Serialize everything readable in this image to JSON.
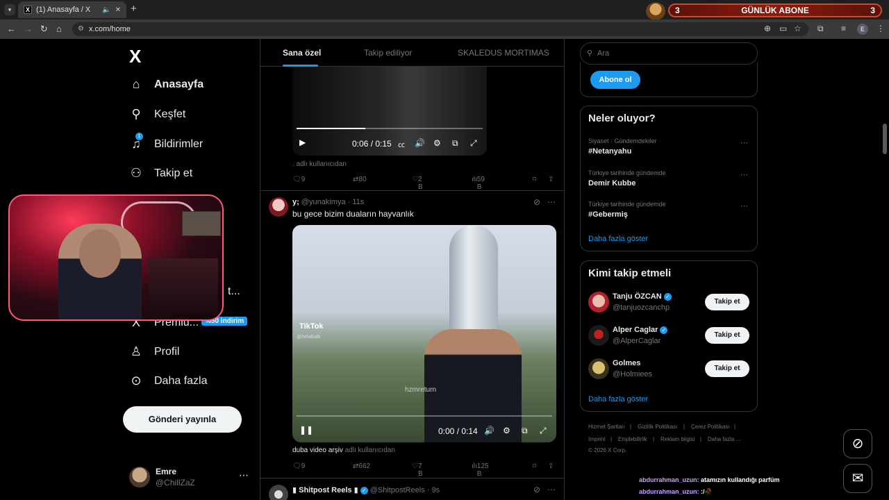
{
  "browser": {
    "tab_title": "(1) Anasayfa / X",
    "tab_favicon": "X",
    "url": "x.com/home",
    "profile_initial": "E",
    "subs_widget": {
      "left_count": "3",
      "label": "GÜNLÜK ABONE",
      "right_count": "3"
    }
  },
  "sidebar": {
    "logo": "X",
    "items": [
      {
        "label": "Anasayfa",
        "icon": "home-icon",
        "glyph": "⌂"
      },
      {
        "label": "Keşfet",
        "icon": "search-icon",
        "glyph": "⚲"
      },
      {
        "label": "Bildirimler",
        "icon": "bell-icon",
        "glyph": "🔔",
        "badge": "1"
      },
      {
        "label": "Takip et",
        "icon": "person-add-icon",
        "glyph": "⚇"
      },
      {
        "label": "t...",
        "icon": "",
        "glyph": ""
      },
      {
        "label": "Premiu...",
        "icon": "x-premium-icon",
        "glyph": "X"
      },
      {
        "label": "Profil",
        "icon": "profile-icon",
        "glyph": "⚲"
      },
      {
        "label": "Daha fazla",
        "icon": "more-circle-icon",
        "glyph": "⋯"
      }
    ],
    "premium_badge": "%50 indirim",
    "post_button": "Gönderi yayınla",
    "user": {
      "name": "Emre",
      "handle": "@ChillZaZ"
    }
  },
  "timeline": {
    "tabs": [
      "Sana özel",
      "Takip ediliyor",
      "SKALEDUS MORTIMAS"
    ],
    "tweet1": {
      "video_time": "0:06 / 0:15",
      "progress": 0.37,
      "attribution": "adlı kullanıcıdan",
      "replies": "9",
      "reposts": "80",
      "likes": "2 B",
      "views": "59 B"
    },
    "tweet2": {
      "display_name": "y;",
      "handle": "@yunakimya",
      "time": "11s",
      "text": "bu gece bizim duaların hayvanlık",
      "video_time": "0:00 / 0:14",
      "progress": 0.0,
      "overlay_tiktok": "TikTok",
      "overlay_tiktok_handle": "@helalkalk",
      "overlay_watermark": "hzmreturn",
      "attribution_name": "duba video arşiv",
      "attribution": "adlı kullanıcıdan",
      "replies": "9",
      "reposts": "662",
      "likes": "7 B",
      "views": "125 B"
    },
    "tweet3": {
      "display_name": "Shitpost Reels",
      "handle": "@ShitpostReels",
      "time": "9s"
    }
  },
  "right": {
    "search_placeholder": "Ara",
    "subscribe_button": "Abone ol",
    "trends_title": "Neler oluyor?",
    "trends": [
      {
        "context": "Siyaset · Gündemdekiler",
        "name": "#Netanyahu"
      },
      {
        "context": "Türkiye tarihinde gündemde",
        "name": "Demir Kubbe"
      },
      {
        "context": "Türkiye tarihinde gündemde",
        "name": "#Gebermiş"
      }
    ],
    "trends_show_more": "Daha fazla göster",
    "who_to_follow_title": "Kimi takip etmeli",
    "who_to_follow": [
      {
        "name": "Tanju ÖZCAN",
        "handle": "@tanjuozcanchp",
        "verified": true,
        "button": "Takip et"
      },
      {
        "name": "Alper Caglar",
        "handle": "@AlperCaglar",
        "verified": true,
        "button": "Takip et"
      },
      {
        "name": "Golmes",
        "handle": "@Holmiees",
        "verified": false,
        "button": "Takip et"
      }
    ],
    "wtf_show_more": "Daha fazla göster",
    "footer": [
      "Hizmet Şartları",
      "Gizlilik Politikası",
      "Çerez Politikası",
      "Imprint",
      "Erişilebilirlik",
      "Reklam bilgisi",
      "Daha fazla ...",
      "© 2026 X Corp."
    ]
  },
  "chat": [
    {
      "user": "abdurrahman_uzun:",
      "text": "atamızın kullandığı parfüm"
    },
    {
      "user": "abdurrahman_uzun:",
      "text": ":/🥀"
    }
  ],
  "colors": {
    "accent": "#1d9bf0",
    "background": "#000000",
    "border": "#2f3336",
    "muted": "#71767b"
  }
}
